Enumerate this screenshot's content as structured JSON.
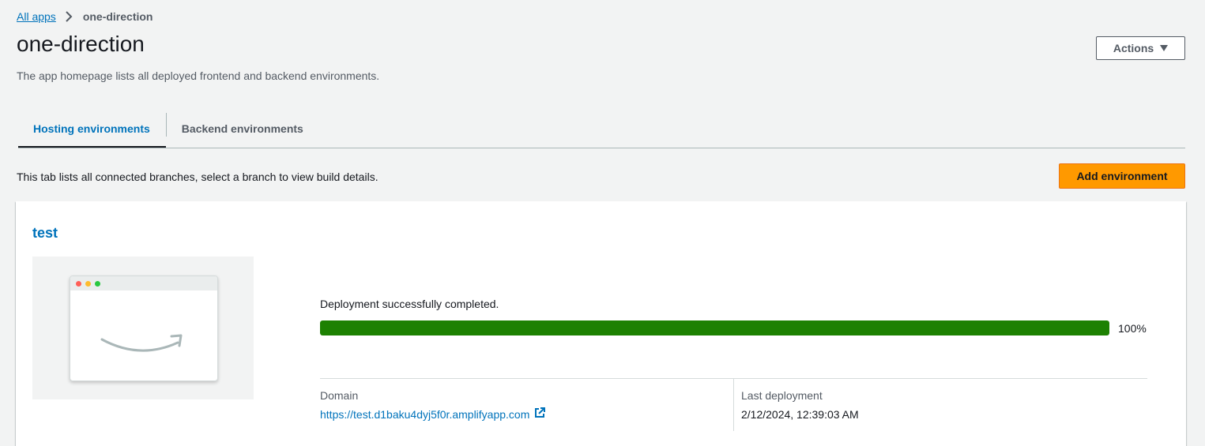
{
  "breadcrumb": {
    "root": "All apps",
    "current": "one-direction"
  },
  "header": {
    "title": "one-direction",
    "description": "The app homepage lists all deployed frontend and backend environments.",
    "actions_label": "Actions"
  },
  "tabs": [
    {
      "label": "Hosting environments",
      "active": true
    },
    {
      "label": "Backend environments",
      "active": false
    }
  ],
  "tab_content": {
    "info": "This tab lists all connected branches, select a branch to view build details.",
    "add_button": "Add environment"
  },
  "branch": {
    "name": "test",
    "status": "Deployment successfully completed.",
    "progress_percent": 100,
    "progress_label": "100%",
    "domain_label": "Domain",
    "domain_url": "https://test.d1baku4dyj5f0r.amplifyapp.com",
    "last_deployment_label": "Last deployment",
    "last_deployment": "2/12/2024, 12:39:03 AM"
  },
  "colors": {
    "accent_link": "#0073bb",
    "primary_button": "#ff9900",
    "success": "#1d8102"
  },
  "icons": {
    "breadcrumb_separator": "chevron-right-icon",
    "actions_caret": "caret-down-icon",
    "external_link": "external-link-icon"
  }
}
